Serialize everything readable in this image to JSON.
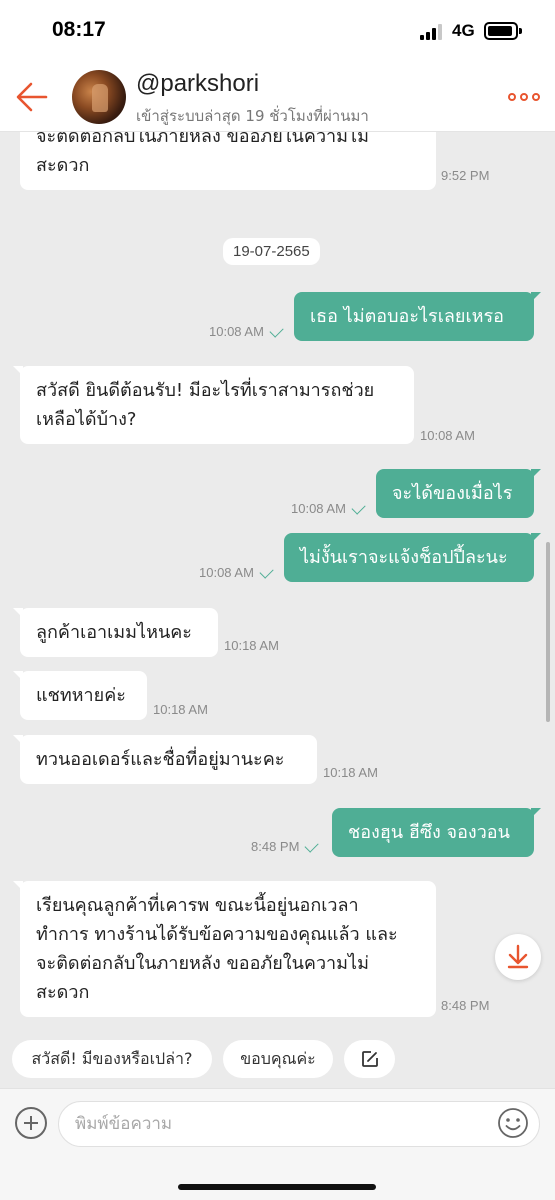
{
  "status_bar": {
    "time": "08:17",
    "network": "4G"
  },
  "header": {
    "username": "@parkshori",
    "last_seen": "เข้าสู่ระบบล่าสุด 19 ชั่วโมงที่ผ่านมา",
    "back_icon": "arrow-left-icon",
    "more_icon": "more-dots-icon"
  },
  "chat": {
    "date_separator": "19-07-2565",
    "messages": [
      {
        "direction": "in",
        "lines": [
          "จะติดต่อกลับในภายหลัง ขออภัยในความไม่",
          "สะดวก"
        ],
        "time": "9:52 PM"
      },
      {
        "direction": "out",
        "text": "เธอ ไม่ตอบอะไรเลยเหรอ",
        "time": "10:08 AM",
        "read": true
      },
      {
        "direction": "in",
        "lines": [
          "สวัสดี ยินดีต้อนรับ! มีอะไรที่เราสามารถช่วย",
          "เหลือได้บ้าง?"
        ],
        "time": "10:08 AM"
      },
      {
        "direction": "out",
        "text": "จะได้ของเมื่อไร",
        "time": "10:08 AM",
        "read": true
      },
      {
        "direction": "out",
        "text": "ไม่งั้นเราจะแจ้งช็อปปี้ละนะ",
        "time": "10:08 AM",
        "read": true
      },
      {
        "direction": "in",
        "text": "ลูกค้าเอาเมมไหนคะ",
        "time": "10:18 AM"
      },
      {
        "direction": "in",
        "text": "แชทหายค่ะ",
        "time": "10:18 AM"
      },
      {
        "direction": "in",
        "text": "ทวนออเดอร์และชื่อที่อยู่มานะคะ",
        "time": "10:18 AM"
      },
      {
        "direction": "out",
        "text": "ชองฮุน ฮีซึง จองวอน",
        "time": "8:48 PM",
        "read": true
      },
      {
        "direction": "in",
        "lines": [
          "เรียนคุณลูกค้าที่เคารพ ขณะนี้อยู่นอกเวลา",
          "ทำการ ทางร้านได้รับข้อความของคุณแล้ว และ",
          "จะติดต่อกลับในภายหลัง ขออภัยในความไม่",
          "สะดวก"
        ],
        "time": "8:48 PM"
      }
    ],
    "scroll_down_icon": "download-arrow-icon"
  },
  "quick_replies": {
    "reply_1": "สวัสดี! มีของหรือเปล่า?",
    "reply_2": "ขอบคุณค่ะ",
    "edit_icon": "edit-icon"
  },
  "composer": {
    "placeholder": "พิมพ์ข้อความ",
    "plus_icon": "plus-circle-icon",
    "emoji_icon": "smiley-icon"
  },
  "colors": {
    "accent": "#e8552f",
    "outgoing_bubble": "#4fae95",
    "background": "#ebebeb"
  }
}
